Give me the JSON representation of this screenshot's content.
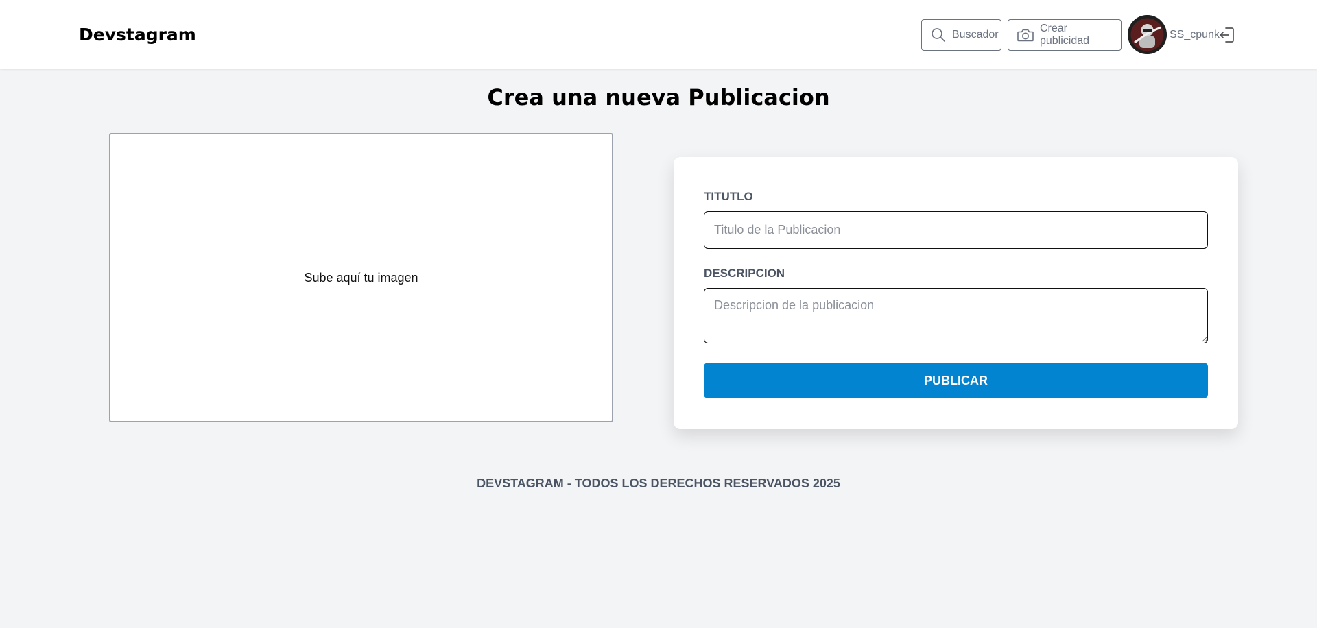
{
  "header": {
    "logo": "Devstagram",
    "search_button": {
      "label": "Buscador",
      "icon": "search-icon"
    },
    "create_button": {
      "label": "Crear publicidad",
      "icon": "camera-icon"
    },
    "user": {
      "username": "SS_cpunk",
      "avatar": "avatar"
    },
    "logout_icon": "logout-icon"
  },
  "main": {
    "title": "Crea una nueva Publicacion",
    "dropzone": {
      "text": "Sube aquí tu imagen"
    },
    "form": {
      "title_label": "TITUTLO",
      "title_placeholder": "Titulo de la Publicacion",
      "title_value": "",
      "description_label": "DESCRIPCION",
      "description_placeholder": "Descripcion de la publicacion",
      "description_value": "",
      "submit_label": "PUBLICAR"
    }
  },
  "footer": {
    "text": "DEVSTAGRAM - TODOS LOS DERECHOS RESERVADOS 2025"
  },
  "colors": {
    "page_background": "#f3f4f6",
    "primary_button": "#0284d1",
    "muted_text": "#4b5563"
  }
}
